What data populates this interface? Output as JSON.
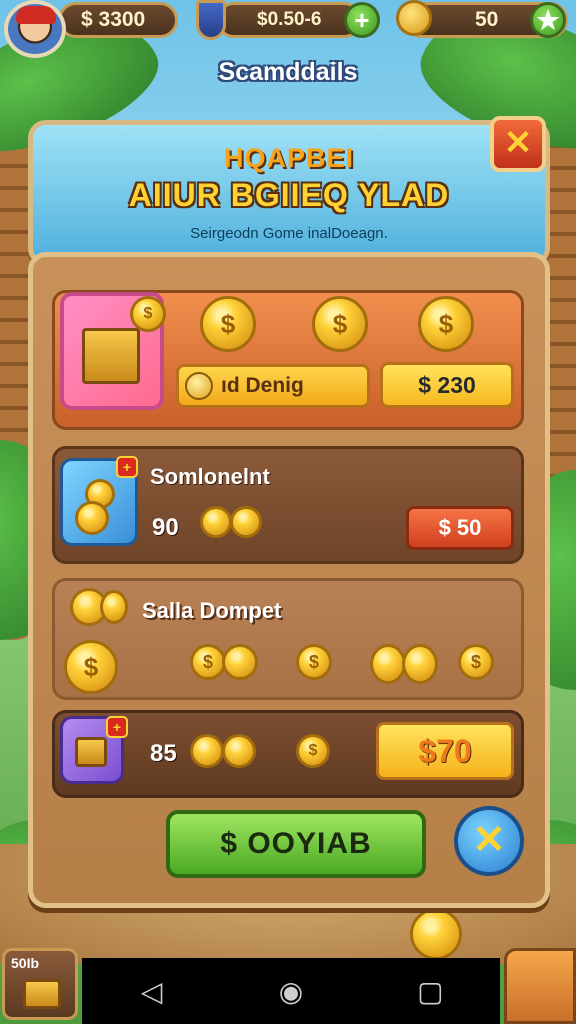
{
  "topbar": {
    "money": "$ 3300",
    "gems": "$0.50-6",
    "coins": "50"
  },
  "screen_title": "Scamddails",
  "dialog": {
    "title_line1": "HQAPBEI",
    "title_line2": "AIIUR BGIIEQ YLAD",
    "subtitle": "Seirgeodn Gome inalDoeagn.",
    "close_symbol": "✕"
  },
  "offers": [
    {
      "label": "ıd Denig",
      "price": "$ 230"
    },
    {
      "title": "Somlonelnt",
      "quantity": "90",
      "price": "$ 50"
    },
    {
      "title": "Salla Dompet"
    },
    {
      "quantity": "85",
      "price": "$70"
    }
  ],
  "badge_symbol": "+",
  "primary_button": "$ OOYIAB",
  "cancel_symbol": "✕",
  "corner_widget_label": "50Ib",
  "nav": {
    "back": "◁",
    "home": "◉",
    "recents": "▢"
  },
  "colors": {
    "accent_green": "#4aa822",
    "accent_orange": "#f08f4e",
    "gold": "#ffd233"
  }
}
